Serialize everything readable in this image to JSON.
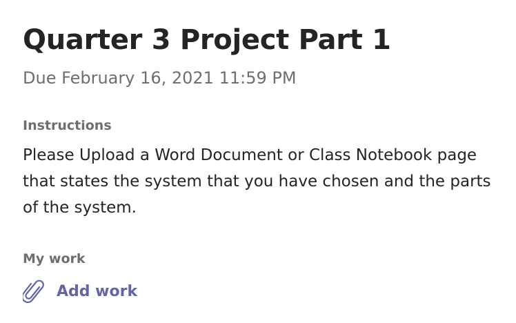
{
  "assignment": {
    "title": "Quarter 3 Project Part 1",
    "due": "Due February 16, 2021 11:59 PM"
  },
  "instructions": {
    "label": "Instructions",
    "text": "Please Upload a Word Document or Class Notebook page that states the system that you have chosen and the parts of the system."
  },
  "my_work": {
    "label": "My work",
    "add_work_label": "Add work",
    "add_work_icon": "paperclip-icon"
  },
  "colors": {
    "accent": "#6264a7",
    "text_primary": "#252423",
    "text_secondary": "#6e6e6e"
  }
}
